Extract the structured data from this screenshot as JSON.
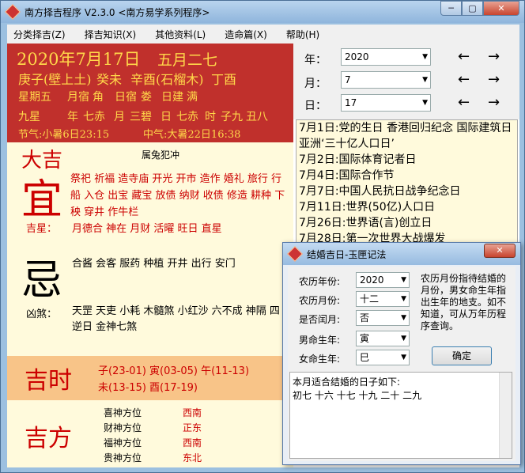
{
  "window": {
    "title": "南方择吉程序 V2.3.0 <南方易学系列程序>",
    "min": "─",
    "max": "▢",
    "close": "✕"
  },
  "menu": [
    "分类择吉(Z)",
    "择吉知识(X)",
    "其他资料(L)",
    "造命篇(X)",
    "帮助(H)"
  ],
  "header": {
    "date": "2020年7月17日",
    "lunar": "五月二七",
    "ganzhi": [
      "庚子(壁上土)",
      "癸未",
      "辛酉(石榴木)",
      "丁酉"
    ],
    "row3": [
      "星期五",
      "月宿",
      "角",
      "日宿",
      "娄",
      "日建",
      "满"
    ],
    "row4": [
      "九星",
      "年",
      "七赤",
      "月",
      "三碧",
      "日",
      "七赤",
      "时",
      "子九",
      "丑八"
    ],
    "jieqi": "节气:小暑6日23:15",
    "zhongqi": "中气:大暑22日16:38"
  },
  "daji": {
    "label": "大吉",
    "clash": "属兔犯冲"
  },
  "yi": {
    "char": "宜",
    "items": "祭祀 祈福 造寺庙 开光 开市 造作 婚礼 旅行 行船 入仓 出宝 藏宝 放债 纳财 收债 修造 耕种 下秧 穿井 作牛栏",
    "jixing_label": "吉星：",
    "jixing": "月德合 神在 月财 活曜 旺日 直星"
  },
  "ji": {
    "char": "忌",
    "items": "合酱 会客 服药 种植 开井 出行 安门",
    "xiongsha_label": "凶煞：",
    "xiongsha": "天罡 天吏 小耗 木髓煞 小红沙 六不成 神隔 四逆日 金神七煞"
  },
  "jishi": {
    "label": "吉时",
    "line1": "子(23-01) 寅(03-05) 午(11-13)",
    "line2": "未(13-15) 酉(17-19)"
  },
  "jifang": {
    "label": "吉方",
    "rows": [
      [
        "喜神方位",
        "西南"
      ],
      [
        "财神方位",
        "正东"
      ],
      [
        "福神方位",
        "西南"
      ],
      [
        "贵神方位",
        "东北"
      ]
    ]
  },
  "selectors": {
    "year_label": "年：",
    "year": "2020",
    "month_label": "月：",
    "month": "7",
    "day_label": "日：",
    "day": "17",
    "left": "←",
    "right": "→"
  },
  "events": [
    "7月1日:党的生日 香港回归纪念 国际建筑日",
    "亚洲‘三十亿人口日’",
    "7月2日:国际体育记者日",
    "7月4日:国际合作节",
    "7月7日:中国人民抗日战争纪念日",
    "7月11日:世界(50亿)人口日",
    "7月26日:世界语(言)创立日",
    "7月28日:第一次世界大战爆发"
  ],
  "dialog": {
    "title": "结婚吉日-玉匣记法",
    "close": "✕",
    "fields": [
      [
        "农历年份:",
        "2020"
      ],
      [
        "农历月份:",
        "十二"
      ],
      [
        "是否闰月:",
        "否"
      ],
      [
        "男命生年:",
        "寅"
      ],
      [
        "女命生年:",
        "巳"
      ]
    ],
    "hint": "农历月份指待结婚的月份，男女命生年指出生年的地支。如不知道，可从万年历程序查询。",
    "ok": "确定",
    "result_line1": "本月适合结婚的日子如下:",
    "result_line2": "初七 十六 十七 十九 二十 二九"
  }
}
